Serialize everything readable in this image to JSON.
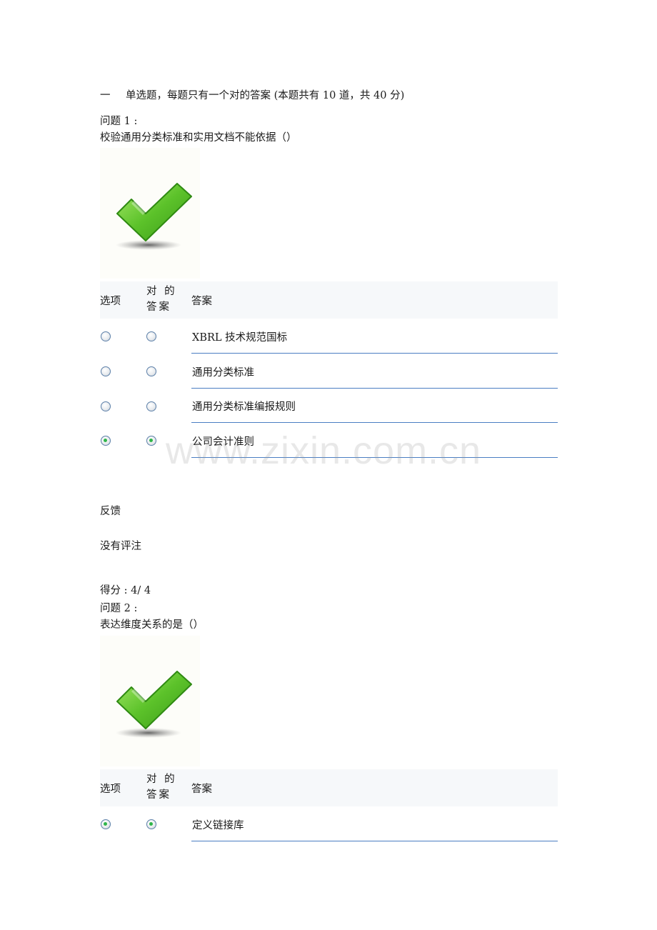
{
  "section": {
    "number": "一",
    "title": "单选题，每题只有一个对的答案 (本题共有 10 道，共 40 分)"
  },
  "table_headers": {
    "option": "选项",
    "correct_answer": "对 的 答案",
    "answer": "答案"
  },
  "questions": [
    {
      "label": "问题 1 :",
      "text": "校验通用分类标准和实用文档不能依据（）",
      "result_icon": "green-checkmark-icon",
      "options": [
        {
          "text": "XBRL 技术规范国标",
          "selected": false,
          "correct": false
        },
        {
          "text": "通用分类标准",
          "selected": false,
          "correct": false
        },
        {
          "text": "通用分类标准编报规则",
          "selected": false,
          "correct": false
        },
        {
          "text": "公司会计准则",
          "selected": true,
          "correct": true
        }
      ],
      "feedback_label": "反馈",
      "feedback_text": "没有评注",
      "score": "得分 : 4/ 4"
    },
    {
      "label": "问题 2 :",
      "text": "表达维度关系的是（）",
      "result_icon": "green-checkmark-icon",
      "options": [
        {
          "text": "定义链接库",
          "selected": true,
          "correct": true
        }
      ]
    }
  ],
  "watermark": "www.zixin.com.cn",
  "colors": {
    "accent_line": "#4a7ec2",
    "radio_checked": "#2fb54a",
    "header_bg": "#f6f8fa",
    "check_green": "#5cc22a"
  }
}
